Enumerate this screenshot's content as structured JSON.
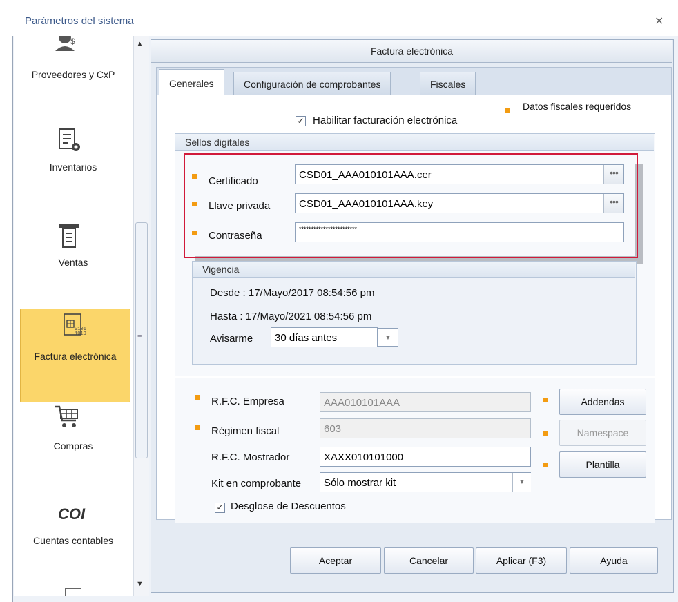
{
  "window": {
    "title": "Parámetros del sistema",
    "close_glyph": "⨯"
  },
  "nav": {
    "items": [
      {
        "label": "Proveedores y CxP",
        "icon": "suppliers-icon"
      },
      {
        "label": "Inventarios",
        "icon": "inventory-icon"
      },
      {
        "label": "Ventas",
        "icon": "sales-icon"
      },
      {
        "label": "Factura electrónica",
        "icon": "e-invoice-icon",
        "selected": true
      },
      {
        "label": "Compras",
        "icon": "cart-icon"
      },
      {
        "label": "Cuentas contables",
        "icon": "coi-icon",
        "icon_text": "COI"
      }
    ]
  },
  "panel": {
    "header": "Factura electrónica"
  },
  "tabs": [
    {
      "label": "Generales",
      "active": true
    },
    {
      "label": "Configuración de comprobantes"
    },
    {
      "label": "Fiscales"
    }
  ],
  "required_legend": "Datos fiscales requeridos",
  "enable_einvoice": {
    "label": "Habilitar facturación electrónica",
    "checked": true
  },
  "sellos": {
    "title": "Sellos digitales",
    "certificado": {
      "label": "Certificado",
      "value": "CSD01_AAA010101AAA.cer"
    },
    "llave": {
      "label": "Llave privada",
      "value": "CSD01_AAA010101AAA.key"
    },
    "contrasena": {
      "label": "Contraseña",
      "value": "************************"
    }
  },
  "vigencia": {
    "title": "Vigencia",
    "desde": "Desde : 17/Mayo/2017 08:54:56 pm",
    "hasta": "Hasta :  17/Mayo/2021 08:54:56 pm",
    "avisarme_label": "Avisarme",
    "avisarme_value": "30 días antes"
  },
  "fiscal": {
    "rfc_empresa": {
      "label": "R.F.C. Empresa",
      "value": "AAA010101AAA"
    },
    "regimen": {
      "label": "Régimen fiscal",
      "value": "603"
    },
    "rfc_mostrador": {
      "label": "R.F.C. Mostrador",
      "value": "XAXX010101000"
    },
    "kit": {
      "label": "Kit en comprobante",
      "value": "Sólo mostrar kit"
    },
    "desglose": {
      "label": "Desglose de Descuentos",
      "checked": true
    }
  },
  "side_buttons": {
    "addendas": "Addendas",
    "namespace": "Namespace",
    "plantilla": "Plantilla"
  },
  "footer": {
    "aceptar": "Aceptar",
    "cancelar": "Cancelar",
    "aplicar": "Aplicar (F3)",
    "ayuda": "Ayuda"
  },
  "colors": {
    "required_bullet": "#f39c12",
    "highlight_box": "#d11a3a",
    "selected_nav": "#fbd66a"
  }
}
